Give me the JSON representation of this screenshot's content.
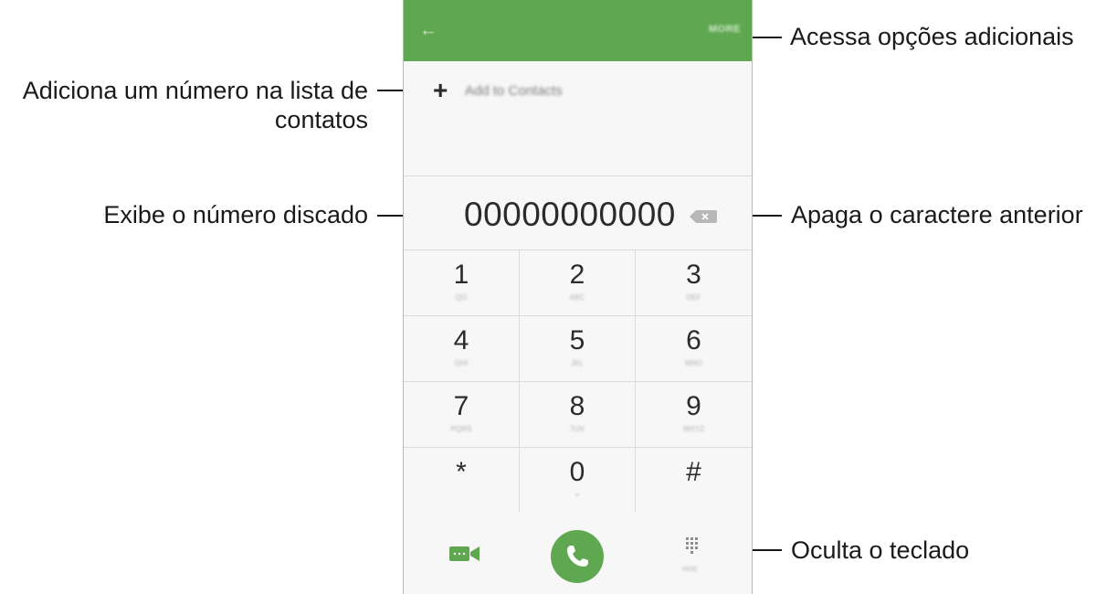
{
  "callouts": {
    "more": "Acessa opções adicionais",
    "add_contact_line1": "Adiciona um número na lista de",
    "add_contact_line2": "contatos",
    "number": "Exibe o número discado",
    "backspace": "Apaga o caractere anterior",
    "hide_keypad": "Oculta o teclado"
  },
  "header": {
    "back_icon": "arrow-left-icon",
    "more_label": "MORE",
    "color": "#5fa851"
  },
  "add_to_contacts": {
    "icon": "plus-icon",
    "label": "Add to Contacts"
  },
  "dialed_number": "00000000000",
  "keypad": {
    "keys": [
      {
        "digit": "1",
        "letters": "QO"
      },
      {
        "digit": "2",
        "letters": "ABC"
      },
      {
        "digit": "3",
        "letters": "DEF"
      },
      {
        "digit": "4",
        "letters": "GHI"
      },
      {
        "digit": "5",
        "letters": "JKL"
      },
      {
        "digit": "6",
        "letters": "MNO"
      },
      {
        "digit": "7",
        "letters": "PQRS"
      },
      {
        "digit": "8",
        "letters": "TUV"
      },
      {
        "digit": "9",
        "letters": "WXYZ"
      },
      {
        "digit": "*",
        "letters": ""
      },
      {
        "digit": "0",
        "letters": "+"
      },
      {
        "digit": "#",
        "letters": ""
      }
    ]
  },
  "bottom_bar": {
    "video_icon": "video-call-icon",
    "call_icon": "phone-icon",
    "hide_icon": "keypad-icon",
    "hide_label": "HIDE",
    "accent": "#5fa851"
  }
}
